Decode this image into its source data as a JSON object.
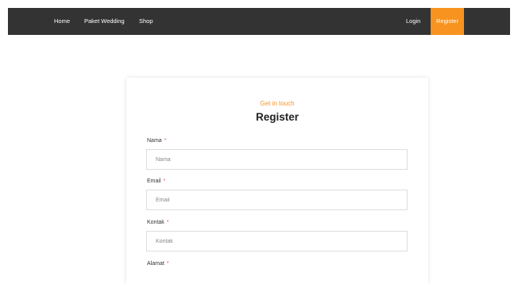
{
  "nav": {
    "home": "Home",
    "paket_wedding": "Paket Wedding",
    "shop": "Shop",
    "login": "Login",
    "register": "Register"
  },
  "form": {
    "kicker": "Get in touch",
    "title": "Register",
    "required_mark": "*",
    "fields": [
      {
        "label": "Nama",
        "placeholder": "Nama"
      },
      {
        "label": "Email",
        "placeholder": "Email"
      },
      {
        "label": "Kontak",
        "placeholder": "Kontak"
      },
      {
        "label": "Alamat"
      }
    ]
  },
  "colors": {
    "navbar_bg": "#333333",
    "accent": "#f7931e",
    "required": "#e05a5a"
  }
}
